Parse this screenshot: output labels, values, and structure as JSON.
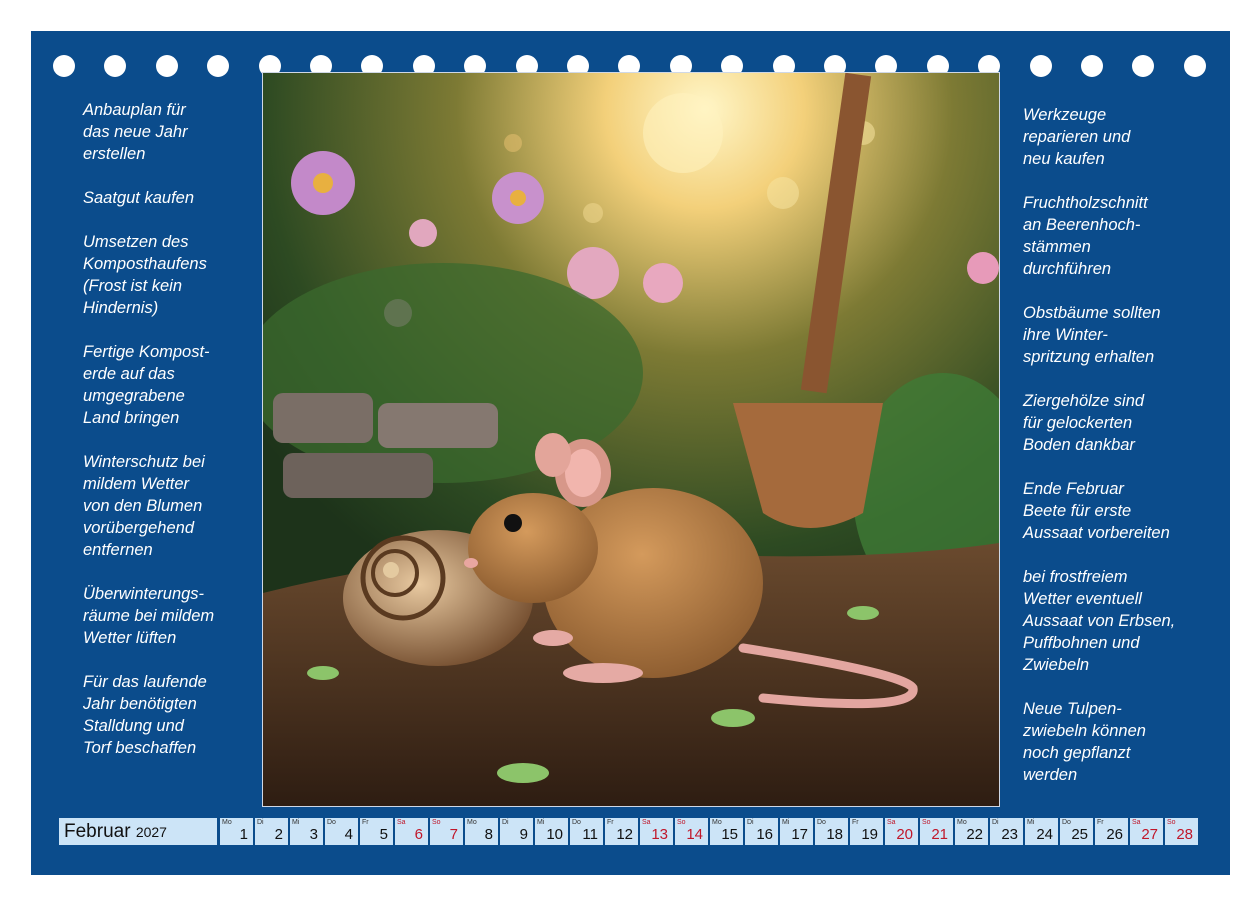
{
  "notes_left": [
    "Anbauplan für\ndas neue Jahr\nerstellen",
    "Saatgut kaufen",
    "Umsetzen des\nKomposthaufens\n(Frost ist kein\nHindernis)",
    "Fertige Kompost-\nerde auf das\numgegrabene\nLand bringen",
    "Winterschutz bei\nmildem Wetter\nvon den Blumen\nvorübergehend\nentfernen",
    "Überwinterungs-\nräume bei mildem\nWetter lüften",
    "Für das laufende\nJahr benötigten\nStalldung und\nTorf beschaffen"
  ],
  "notes_right": [
    "Werkzeuge\nreparieren und\nneu kaufen",
    "Fruchtholzschnitt\nan Beerenhoch-\nstämmen\ndurchführen",
    "Obstbäume sollten\nihre Winter-\nspritzung erhalten",
    "Ziergehölze sind\nfür gelockerten\nBoden dankbar",
    "Ende Februar\nBeete für erste\nAussaat vorbereiten",
    "bei frostfreiem\nWetter eventuell\nAussaat von Erbsen,\nPuffbohnen und\nZwiebeln",
    "Neue Tulpen-\nzwiebeln können\nnoch gepflanzt\nwerden"
  ],
  "calendar": {
    "month": "Februar",
    "year": "2027",
    "days": [
      {
        "wd": "Mo",
        "n": "1",
        "weekend": false
      },
      {
        "wd": "Di",
        "n": "2",
        "weekend": false
      },
      {
        "wd": "Mi",
        "n": "3",
        "weekend": false
      },
      {
        "wd": "Do",
        "n": "4",
        "weekend": false
      },
      {
        "wd": "Fr",
        "n": "5",
        "weekend": false
      },
      {
        "wd": "Sa",
        "n": "6",
        "weekend": true
      },
      {
        "wd": "So",
        "n": "7",
        "weekend": true
      },
      {
        "wd": "Mo",
        "n": "8",
        "weekend": false
      },
      {
        "wd": "Di",
        "n": "9",
        "weekend": false
      },
      {
        "wd": "Mi",
        "n": "10",
        "weekend": false
      },
      {
        "wd": "Do",
        "n": "11",
        "weekend": false
      },
      {
        "wd": "Fr",
        "n": "12",
        "weekend": false
      },
      {
        "wd": "Sa",
        "n": "13",
        "weekend": true
      },
      {
        "wd": "So",
        "n": "14",
        "weekend": true
      },
      {
        "wd": "Mo",
        "n": "15",
        "weekend": false
      },
      {
        "wd": "Di",
        "n": "16",
        "weekend": false
      },
      {
        "wd": "Mi",
        "n": "17",
        "weekend": false
      },
      {
        "wd": "Do",
        "n": "18",
        "weekend": false
      },
      {
        "wd": "Fr",
        "n": "19",
        "weekend": false
      },
      {
        "wd": "Sa",
        "n": "20",
        "weekend": true
      },
      {
        "wd": "So",
        "n": "21",
        "weekend": true
      },
      {
        "wd": "Mo",
        "n": "22",
        "weekend": false
      },
      {
        "wd": "Di",
        "n": "23",
        "weekend": false
      },
      {
        "wd": "Mi",
        "n": "24",
        "weekend": false
      },
      {
        "wd": "Do",
        "n": "25",
        "weekend": false
      },
      {
        "wd": "Fr",
        "n": "26",
        "weekend": false
      },
      {
        "wd": "Sa",
        "n": "27",
        "weekend": true
      },
      {
        "wd": "So",
        "n": "28",
        "weekend": true
      }
    ]
  },
  "colors": {
    "page_background": "#0b4c8c",
    "day_cell": "#cce4f7",
    "weekend_text": "#c0172a"
  }
}
